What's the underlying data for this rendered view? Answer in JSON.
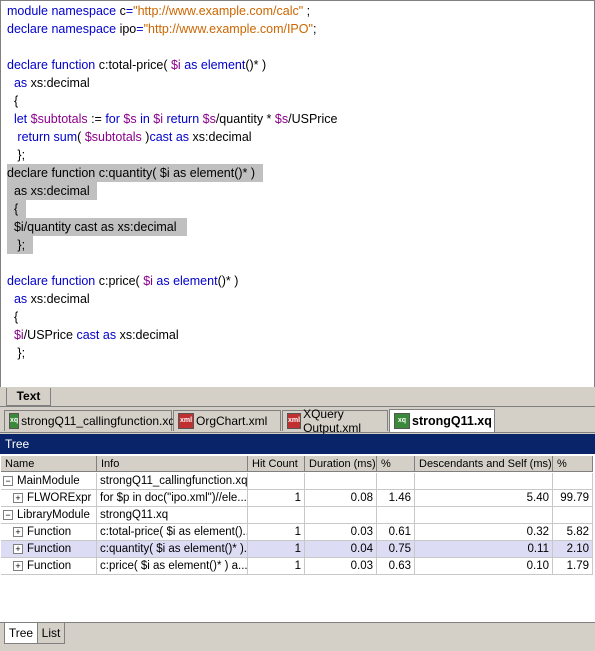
{
  "editor": {
    "lines": [
      [
        {
          "t": "module namespace ",
          "c": "k"
        },
        {
          "t": "c",
          "c": "t"
        },
        {
          "t": "=",
          "c": "k"
        },
        {
          "t": "\"http://www.example.com/calc\"",
          "c": "s"
        },
        {
          "t": " ;",
          "c": "t"
        }
      ],
      [
        {
          "t": "declare namespace ",
          "c": "k"
        },
        {
          "t": "ipo",
          "c": "t"
        },
        {
          "t": "=",
          "c": "k"
        },
        {
          "t": "\"http://www.example.com/IPO\"",
          "c": "s"
        },
        {
          "t": ";",
          "c": "t"
        }
      ],
      [],
      [
        {
          "t": "declare function ",
          "c": "k"
        },
        {
          "t": "c:total-price( ",
          "c": "t"
        },
        {
          "t": "$i",
          "c": "v"
        },
        {
          "t": " as ",
          "c": "k"
        },
        {
          "t": "element",
          "c": "k"
        },
        {
          "t": "()* )",
          "c": "t"
        }
      ],
      [
        {
          "t": "  as ",
          "c": "k"
        },
        {
          "t": "xs:decimal",
          "c": "t"
        }
      ],
      [
        {
          "t": "  {",
          "c": "t"
        }
      ],
      [
        {
          "t": "  let ",
          "c": "k"
        },
        {
          "t": "$subtotals",
          "c": "v"
        },
        {
          "t": " := ",
          "c": "t"
        },
        {
          "t": "for ",
          "c": "k"
        },
        {
          "t": "$s",
          "c": "v"
        },
        {
          "t": " in ",
          "c": "k"
        },
        {
          "t": "$i",
          "c": "v"
        },
        {
          "t": " return ",
          "c": "k"
        },
        {
          "t": "$s",
          "c": "v"
        },
        {
          "t": "/quantity * ",
          "c": "t"
        },
        {
          "t": "$s",
          "c": "v"
        },
        {
          "t": "/USPrice",
          "c": "t"
        }
      ],
      [
        {
          "t": "   return ",
          "c": "k"
        },
        {
          "t": "sum",
          "c": "k"
        },
        {
          "t": "( ",
          "c": "t"
        },
        {
          "t": "$subtotals",
          "c": "v"
        },
        {
          "t": " )",
          "c": "t"
        },
        {
          "t": "cast as ",
          "c": "k"
        },
        {
          "t": "xs:decimal",
          "c": "t"
        }
      ],
      [
        {
          "t": "   };",
          "c": "t"
        }
      ],
      [
        {
          "t": "declare function c:quantity( $i as element()* ) ",
          "c": "t"
        }
      ],
      [
        {
          "t": "  as xs:decimal ",
          "c": "t"
        }
      ],
      [
        {
          "t": "  { ",
          "c": "t"
        }
      ],
      [
        {
          "t": "  $i/quantity cast as xs:decimal  ",
          "c": "t"
        }
      ],
      [
        {
          "t": "   }; ",
          "c": "t"
        }
      ],
      [],
      [
        {
          "t": "declare function ",
          "c": "k"
        },
        {
          "t": "c:price( ",
          "c": "t"
        },
        {
          "t": "$i",
          "c": "v"
        },
        {
          "t": " as ",
          "c": "k"
        },
        {
          "t": "element",
          "c": "k"
        },
        {
          "t": "()* )",
          "c": "t"
        }
      ],
      [
        {
          "t": "  as ",
          "c": "k"
        },
        {
          "t": "xs:decimal",
          "c": "t"
        }
      ],
      [
        {
          "t": "  {",
          "c": "t"
        }
      ],
      [
        {
          "t": "  ",
          "c": "t"
        },
        {
          "t": "$i",
          "c": "v"
        },
        {
          "t": "/USPrice ",
          "c": "t"
        },
        {
          "t": "cast as ",
          "c": "k"
        },
        {
          "t": "xs:decimal",
          "c": "t"
        }
      ],
      [
        {
          "t": "   };",
          "c": "t"
        }
      ]
    ],
    "highlighted_lines": [
      9,
      10,
      11,
      12,
      13
    ]
  },
  "view_tabs": {
    "text_label": "Text"
  },
  "file_tabs": [
    {
      "label": "strongQ11_callingfunction.xq",
      "icon": "xq",
      "active": false
    },
    {
      "label": "OrgChart.xml",
      "icon": "xml",
      "active": false
    },
    {
      "label": "XQuery Output.xml",
      "icon": "xml",
      "active": false
    },
    {
      "label": "strongQ11.xq",
      "icon": "xq",
      "active": true
    }
  ],
  "tree": {
    "title": "Tree",
    "headers": [
      "Name",
      "Info",
      "Hit Count",
      "Duration (ms)",
      "%",
      "Descendants and Self (ms)",
      "%"
    ],
    "rows": [
      {
        "expander": "−",
        "indent": 0,
        "name": "MainModule",
        "info": "strongQ11_callingfunction.xq",
        "hit": "",
        "dur": "",
        "pct": "",
        "desc": "",
        "pct2": "",
        "selected": false
      },
      {
        "expander": "+",
        "indent": 1,
        "name": "FLWORExpr",
        "info": "for $p in doc(\"ipo.xml\")//ele...",
        "hit": "1",
        "dur": "0.08",
        "pct": "1.46",
        "desc": "5.40",
        "pct2": "99.79",
        "selected": false
      },
      {
        "expander": "−",
        "indent": 0,
        "name": "LibraryModule",
        "info": "strongQ11.xq",
        "hit": "",
        "dur": "",
        "pct": "",
        "desc": "",
        "pct2": "",
        "selected": false
      },
      {
        "expander": "+",
        "indent": 1,
        "name": "Function",
        "info": "c:total-price( $i as element()...",
        "hit": "1",
        "dur": "0.03",
        "pct": "0.61",
        "desc": "0.32",
        "pct2": "5.82",
        "selected": false
      },
      {
        "expander": "+",
        "indent": 1,
        "name": "Function",
        "info": "c:quantity( $i as element()* )...",
        "hit": "1",
        "dur": "0.04",
        "pct": "0.75",
        "desc": "0.11",
        "pct2": "2.10",
        "selected": true
      },
      {
        "expander": "+",
        "indent": 1,
        "name": "Function",
        "info": "c:price( $i as element()* ) a...",
        "hit": "1",
        "dur": "0.03",
        "pct": "0.63",
        "desc": "0.10",
        "pct2": "1.79",
        "selected": false
      }
    ]
  },
  "bottom_tabs": [
    {
      "label": "Tree",
      "active": true
    },
    {
      "label": "List",
      "active": false
    }
  ]
}
